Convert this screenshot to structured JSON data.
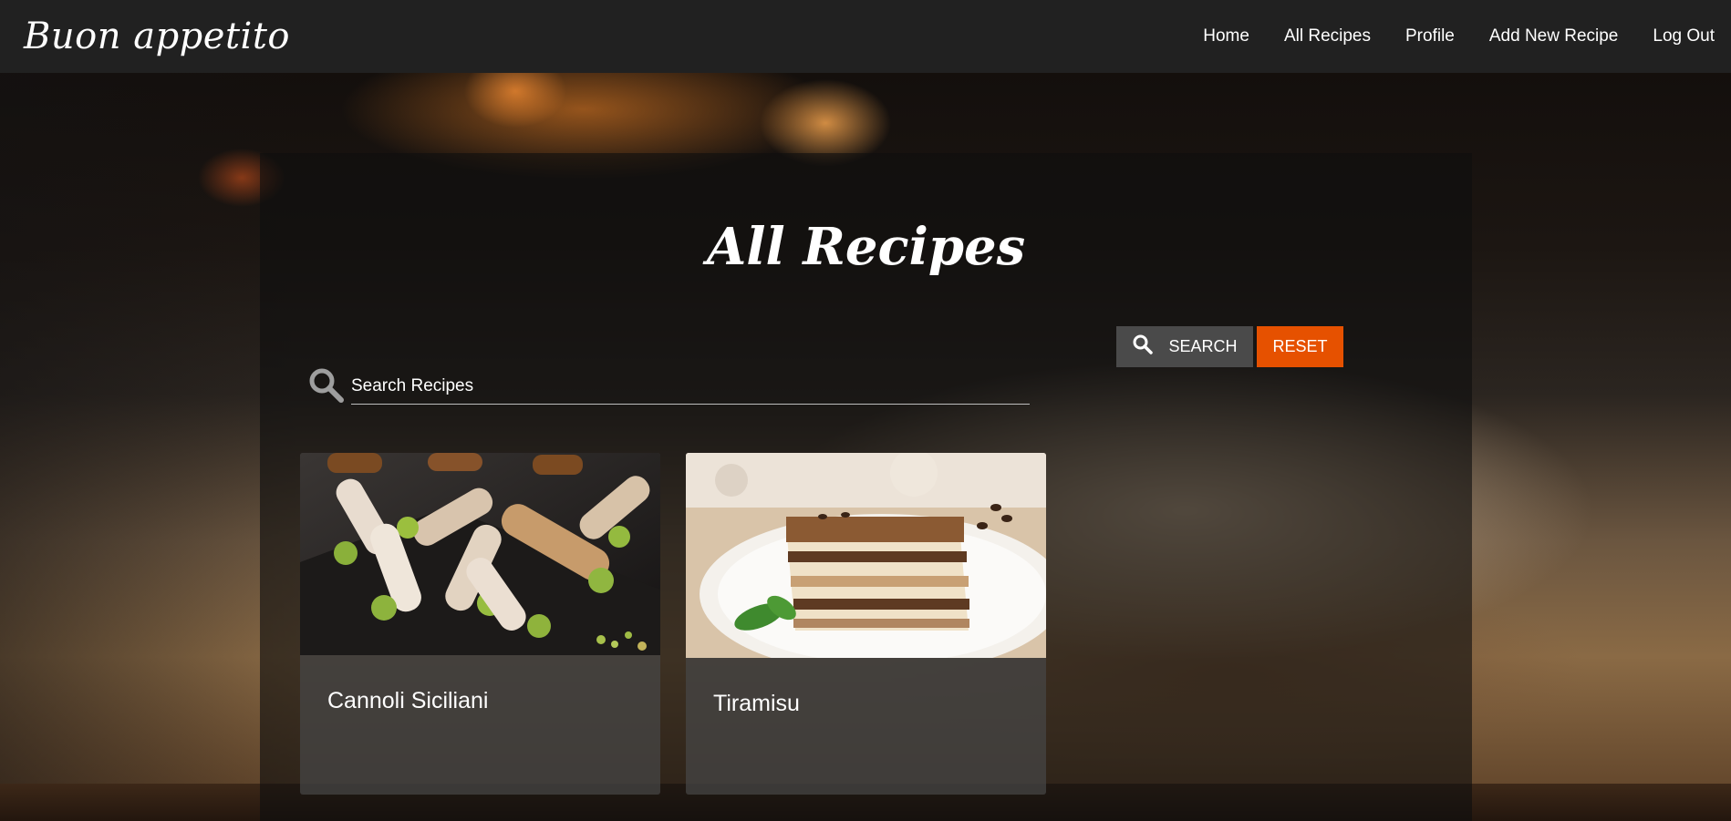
{
  "brand": {
    "name": "Buon appetito"
  },
  "nav": {
    "items": [
      {
        "label": "Home"
      },
      {
        "label": "All Recipes"
      },
      {
        "label": "Profile"
      },
      {
        "label": "Add New Recipe"
      },
      {
        "label": "Log Out"
      }
    ]
  },
  "main": {
    "title": "All Recipes",
    "search": {
      "placeholder": "Search Recipes",
      "value": "",
      "icon": "search-icon"
    },
    "buttons": {
      "search_label": "SEARCH",
      "reset_label": "RESET"
    },
    "recipes": [
      {
        "title": "Cannoli Siciliani",
        "image": "cannoli-photo"
      },
      {
        "title": "Tiramisu",
        "image": "tiramisu-photo"
      }
    ]
  },
  "colors": {
    "navbar": "#212121",
    "reset_button": "#e65100",
    "search_button": "#4a4a4a",
    "text": "#ffffff"
  }
}
